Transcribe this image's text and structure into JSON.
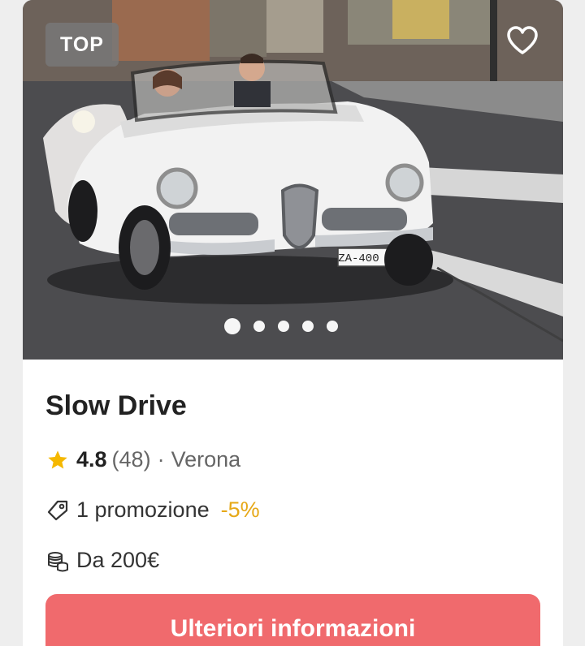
{
  "card": {
    "badge": "TOP",
    "image": {
      "description_icon": "vintage-white-convertible-photo",
      "plate": "ZA-400 HA",
      "slide_count": 5,
      "active_slide": 1
    },
    "title": "Slow Drive",
    "rating": {
      "value": "4.8",
      "count": "(48)",
      "separator": "·",
      "location": "Verona"
    },
    "promotion": {
      "text": "1 promozione",
      "discount": "-5%"
    },
    "price": {
      "text": "Da 200€"
    },
    "cta_label": "Ulteriori informazioni"
  },
  "colors": {
    "cta": "#f06a6d",
    "star": "#f5b800",
    "discount": "#e6a817"
  },
  "icons": {
    "favorite": "heart-outline-icon",
    "rating": "star-icon",
    "promotion": "price-tag-icon",
    "price": "coins-icon"
  }
}
